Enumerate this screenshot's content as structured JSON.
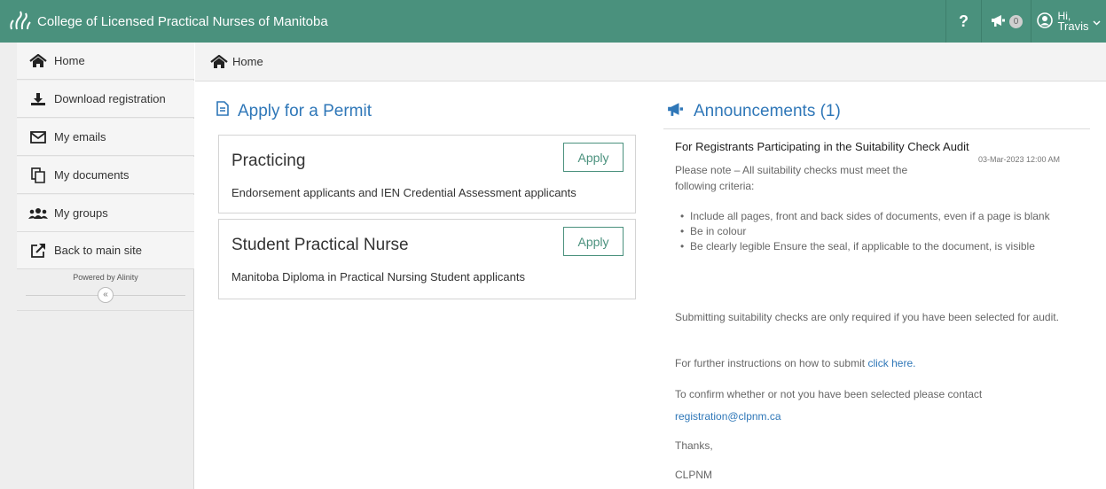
{
  "header": {
    "title": "College of Licensed Practical Nurses of Manitoba",
    "help_label": "?",
    "announcement_count": "0",
    "greeting_hi": "Hi,",
    "greeting_name": "Travis"
  },
  "sidebar": {
    "items": [
      {
        "label": "Home",
        "icon": "home-icon"
      },
      {
        "label": "Download registration",
        "icon": "download-icon"
      },
      {
        "label": "My emails",
        "icon": "envelope-icon"
      },
      {
        "label": "My documents",
        "icon": "documents-icon"
      },
      {
        "label": "My groups",
        "icon": "groups-icon"
      },
      {
        "label": "Back to main site",
        "icon": "external-link-icon"
      }
    ],
    "powered_by": "Powered by Alinity",
    "collapse_label": "«"
  },
  "breadcrumb": {
    "label": "Home"
  },
  "permits": {
    "heading": "Apply for a Permit",
    "cards": [
      {
        "title": "Practicing",
        "description": "Endorsement applicants and IEN Credential Assessment applicants",
        "button": "Apply"
      },
      {
        "title": "Student Practical Nurse",
        "description": "Manitoba Diploma in Practical Nursing Student applicants",
        "button": "Apply"
      }
    ]
  },
  "announcements": {
    "heading": "Announcements (1)",
    "item": {
      "title": "For Registrants Participating in the Suitability Check Audit",
      "date": "03-Mar-2023 12:00 AM",
      "intro_line1": "Please note – All suitability checks must meet the",
      "intro_line2": "following criteria:",
      "bullets": [
        "Include all pages, front and back sides of documents, even if a page is blank",
        "Be in colour",
        "Be clearly legible  Ensure the seal, if applicable to the document, is visible"
      ],
      "audit_note": "Submitting suitability checks are only required if you have been selected for audit.",
      "instructions_prefix": "For further instructions on how to submit",
      "instructions_link": "click here.",
      "confirm_text": "To confirm whether or not you have been selected please contact",
      "email": "registration@clpnm.ca",
      "thanks": "Thanks,",
      "signoff": "CLPNM"
    }
  },
  "colors": {
    "header_bg": "#4a917d",
    "accent_blue": "#2f77b8"
  }
}
